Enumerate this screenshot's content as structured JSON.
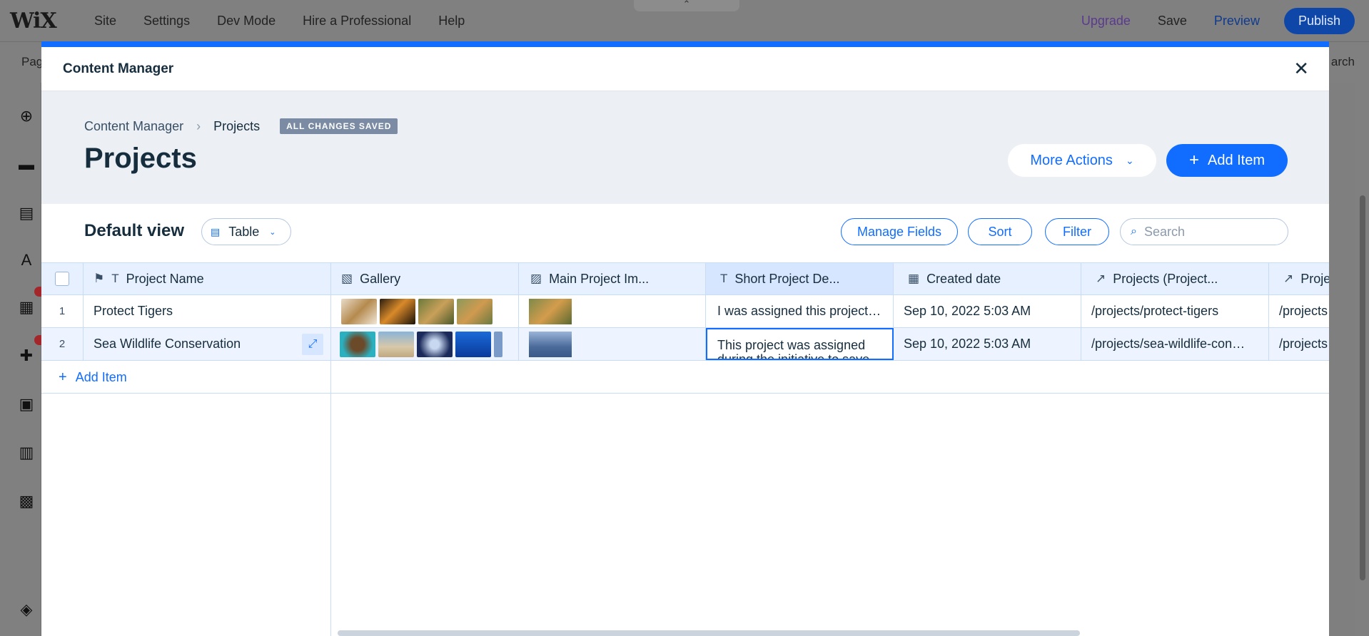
{
  "editor": {
    "logo": "WiX",
    "nav": [
      "Site",
      "Settings",
      "Dev Mode",
      "Hire a Professional",
      "Help"
    ],
    "upgrade": "Upgrade",
    "save": "Save",
    "preview": "Preview",
    "publish": "Publish",
    "pages_label": "Pag",
    "search_label": "arch"
  },
  "modal": {
    "title": "Content Manager",
    "breadcrumb": {
      "root": "Content Manager",
      "current": "Projects"
    },
    "status_badge": "ALL CHANGES SAVED",
    "page_title": "Projects",
    "more_actions": "More Actions",
    "add_item": "Add Item",
    "view": {
      "name": "Default view",
      "type": "Table"
    },
    "toolbar": {
      "manage_fields": "Manage Fields",
      "sort": "Sort",
      "filter": "Filter",
      "search_placeholder": "Search"
    }
  },
  "table": {
    "columns": [
      {
        "label": "Project Name",
        "icon": "text-icon"
      },
      {
        "label": "Gallery",
        "icon": "gallery-icon"
      },
      {
        "label": "Main Project Im...",
        "icon": "image-icon"
      },
      {
        "label": "Short Project De...",
        "icon": "text-icon"
      },
      {
        "label": "Created date",
        "icon": "calendar-icon"
      },
      {
        "label": "Projects (Project...",
        "icon": "external-link-icon"
      },
      {
        "label": "Proje",
        "icon": "external-link-icon"
      }
    ],
    "rows": [
      {
        "num": "1",
        "name": "Protect Tigers",
        "description": "I was assigned this project…",
        "created": "Sep 10, 2022 5:03 AM",
        "link": "/projects/protect-tigers",
        "link2": "/projects"
      },
      {
        "num": "2",
        "name": "Sea Wildlife Conservation",
        "description": "This project was assigned during the initiative to save",
        "created": "Sep 10, 2022 5:03 AM",
        "link": "/projects/sea-wildlife-con…",
        "link2": "/projects"
      }
    ],
    "add_item": "Add Item"
  },
  "colors": {
    "accent": "#116dff",
    "badge": "#7a8ba3",
    "publish": "#0f47a8",
    "upgrade": "#5a3a8e"
  }
}
